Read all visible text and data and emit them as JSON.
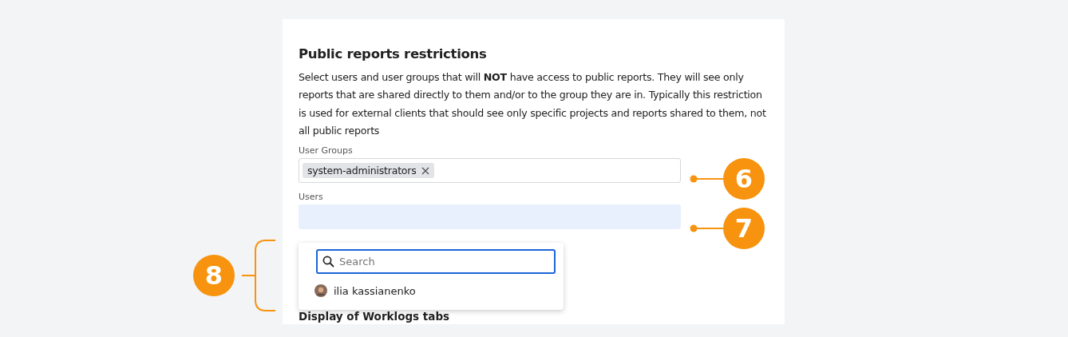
{
  "section": {
    "title": "Public reports restrictions",
    "description": "Select users and user groups that will **NOT** have access to public reports. They will see only reports that are shared directly to them and/or to the group they are in. Typically this restriction is used for external clients that should see only specific projects and reports shared to them, not all public reports"
  },
  "user_groups": {
    "label": "User Groups",
    "tags": [
      "system-administrators"
    ]
  },
  "users": {
    "label": "Users",
    "focused": true
  },
  "dropdown": {
    "search_placeholder": "Search",
    "options": [
      "ilia kassianenko"
    ]
  },
  "next_section": {
    "title": "Display of Worklogs tabs"
  },
  "callouts": [
    "6",
    "7",
    "8"
  ]
}
